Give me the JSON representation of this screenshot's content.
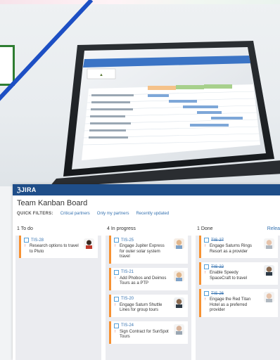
{
  "jira": {
    "logo": "ℨJIRA",
    "board_title": "Team Kanban Board",
    "quick_filters_label": "QUICK FILTERS:",
    "filters": [
      "Critical partners",
      "Only my partners",
      "Recently updated"
    ]
  },
  "columns": [
    {
      "header": "1 To do",
      "cards": [
        {
          "key": "TIS-28",
          "summary": "Research options to travel to Pluto"
        }
      ]
    },
    {
      "header": "4 In progress",
      "cards": [
        {
          "key": "TIS-25",
          "summary": "Engage Jupiter Express for outer solar system travel"
        },
        {
          "key": "TIS-21",
          "summary": "Add Phobos and Deimos Tours as a PTP"
        },
        {
          "key": "TIS-20",
          "summary": "Engage Saturn Shuttle Lines for group tours"
        },
        {
          "key": "TIS-24",
          "summary": "Sign Contract for SunSpot Tours"
        }
      ]
    },
    {
      "header": "1 Done",
      "release": "Relea",
      "cards": [
        {
          "key": "TIS-27",
          "summary": "Engage Saturns Rings Resort as a provider"
        },
        {
          "key": "TIS-22",
          "summary": "Enable Speedy SpaceCraft to travel"
        },
        {
          "key": "TIS-26",
          "summary": "Engage the Red Titan Hotel as a preferred provider"
        }
      ]
    }
  ],
  "colors": {
    "jira_bar": "#1f4e89",
    "link": "#3572b0",
    "card_accent": "#f79232",
    "priority": "#d04437",
    "diagonal_line": "#1d4fc4",
    "frame_green": "#2e7d32"
  }
}
